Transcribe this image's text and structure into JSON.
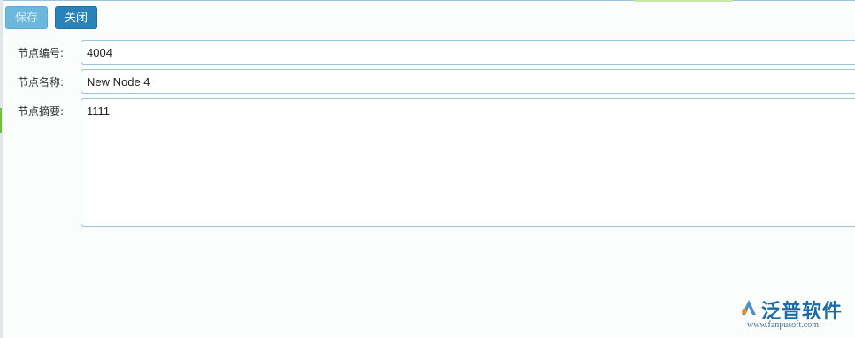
{
  "toolbar": {
    "save_label": "保存",
    "close_label": "关闭"
  },
  "form": {
    "node_number": {
      "label": "节点编号:",
      "value": "4004"
    },
    "node_name": {
      "label": "节点名称:",
      "value": "New Node 4"
    },
    "node_summary": {
      "label": "节点摘要:",
      "value": "1111"
    }
  },
  "watermark": {
    "brand": "泛普软件",
    "url": "www.fanpusoft.com"
  },
  "colors": {
    "accent": "#2a82ba",
    "save_button": "#6cb7dc",
    "field_border": "#9cc3d6",
    "brand": "#1d6ba6"
  }
}
